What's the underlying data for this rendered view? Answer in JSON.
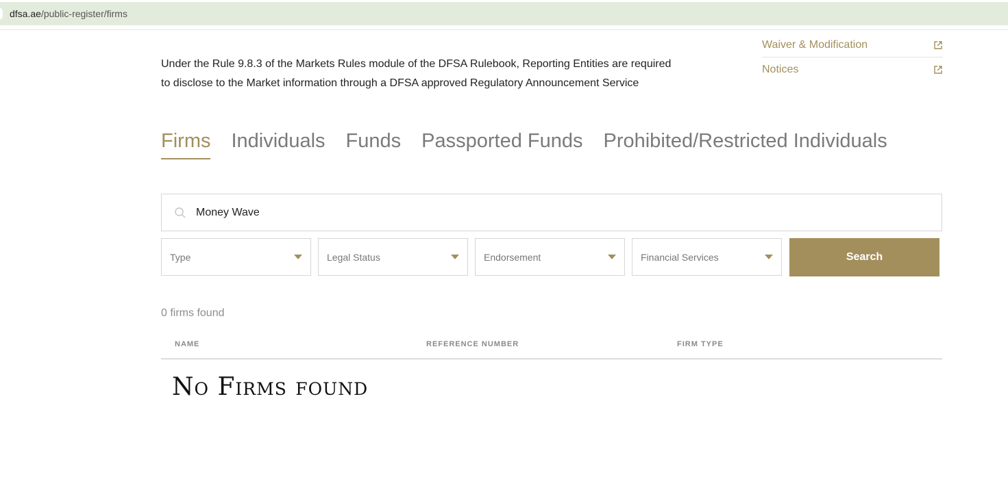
{
  "browser": {
    "url_host": "dfsa.ae",
    "url_path": "/public-register/firms"
  },
  "side_links": [
    {
      "label": "Waiver & Modification",
      "icon": "external-link-icon"
    },
    {
      "label": "Notices",
      "icon": "external-link-icon"
    }
  ],
  "intro": {
    "text": "Under the Rule 9.8.3 of the Markets Rules module of the DFSA Rulebook, Reporting Entities are required to disclose to the Market information through a DFSA approved Regulatory Announcement Service"
  },
  "tabs": [
    {
      "label": "Firms",
      "active": true
    },
    {
      "label": "Individuals",
      "active": false
    },
    {
      "label": "Funds",
      "active": false
    },
    {
      "label": "Passported Funds",
      "active": false
    },
    {
      "label": "Prohibited/Restricted Individuals",
      "active": false
    }
  ],
  "search": {
    "value": "Money Wave",
    "icon": "search-icon"
  },
  "filters": [
    {
      "label": "Type"
    },
    {
      "label": "Legal Status"
    },
    {
      "label": "Endorsement"
    },
    {
      "label": "Financial Services"
    }
  ],
  "search_button": {
    "label": "Search"
  },
  "results": {
    "count_text": "0 firms found",
    "columns": [
      "NAME",
      "REFERENCE NUMBER",
      "FIRM TYPE"
    ],
    "empty_text": "No Firms found"
  },
  "colors": {
    "accent": "#a38f5c",
    "url_bar": "#e3ecdc"
  }
}
